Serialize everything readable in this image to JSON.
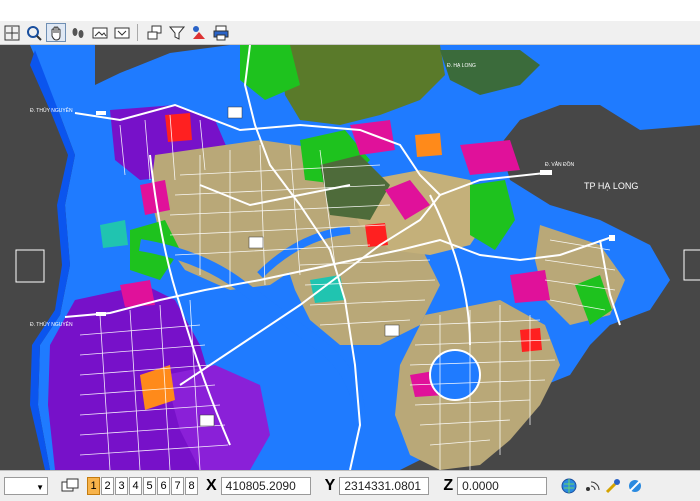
{
  "toolbar": {
    "icons": [
      "pan-extents-icon",
      "zoom-icon",
      "hand-pan-icon",
      "footprint-icon",
      "window-icon",
      "window-zoom-icon",
      "layer-icon",
      "filter-icon",
      "select-tool-icon",
      "print-icon"
    ]
  },
  "map": {
    "labels": {
      "ha_long": "TP HẠ LONG",
      "d_ha_long": "Đ. HẠ LONG",
      "d_thuy_nguyen_top": "Đ. THỦY NGUYÊN",
      "d_thuy_nguyen_left": "Đ. THỦY NGUYÊN",
      "d_van_don": "Đ. VÂN ĐỒN"
    },
    "colors": {
      "water": "#1f7bff",
      "deep_water": "#0b55ee",
      "background": "#474747",
      "residential": "#7711c9",
      "commercial": "#e0119a",
      "green": "#1ec21e",
      "mixed": "#b9a878",
      "road": "#ffffff"
    }
  },
  "status": {
    "viewport_tabs": [
      "1",
      "2",
      "3",
      "4",
      "5",
      "6",
      "7",
      "8"
    ],
    "active_tab": "1",
    "x_label": "X",
    "x_value": "410805.2090",
    "y_label": "Y",
    "y_value": "2314331.0801",
    "z_label": "Z",
    "z_value": "0.0000"
  }
}
